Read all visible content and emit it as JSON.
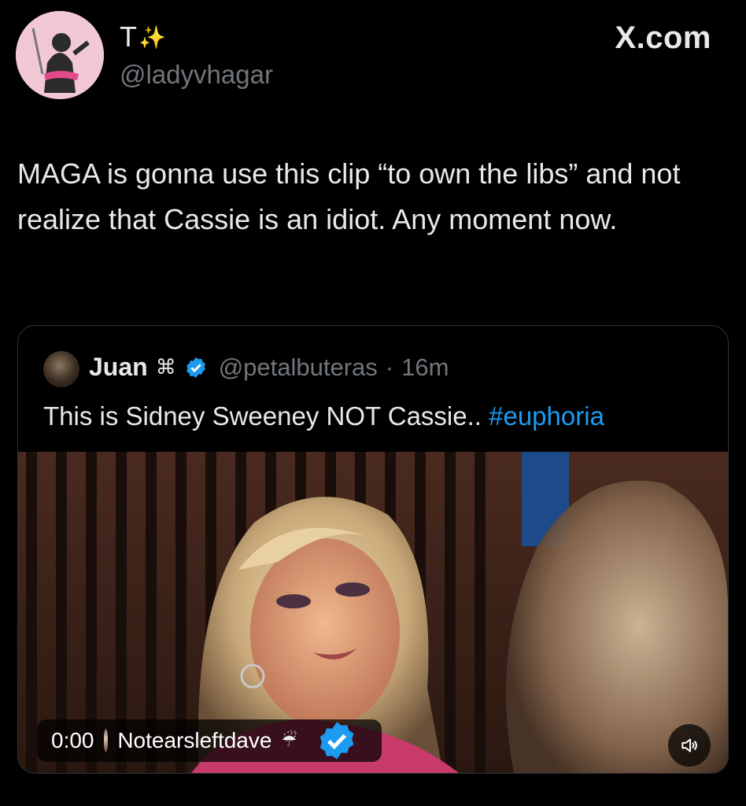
{
  "header": {
    "display_name": "T",
    "name_emoji": "✨",
    "handle": "@ladyvhagar",
    "site_label": "X.com"
  },
  "tweet": {
    "text": "MAGA is gonna use this clip “to own the libs” and not realize that Cassie is an idiot. Any moment now."
  },
  "quote": {
    "name": "Juan",
    "name_glyph": "⌘",
    "verified": true,
    "handle": "@petalbuteras",
    "separator": "·",
    "time": "16m",
    "text": "This is Sidney Sweeney NOT Cassie..",
    "hashtag": "#euphoria"
  },
  "video": {
    "timestamp": "0:00",
    "uploader": "Notearsleftdave",
    "uploader_emoji": "☔",
    "uploader_verified": true,
    "mute_icon": "speaker-muted-icon"
  },
  "colors": {
    "background": "#000000",
    "text": "#e7e9ea",
    "secondary": "#71767b",
    "accent": "#1d9bf0",
    "border": "#2f3336"
  }
}
